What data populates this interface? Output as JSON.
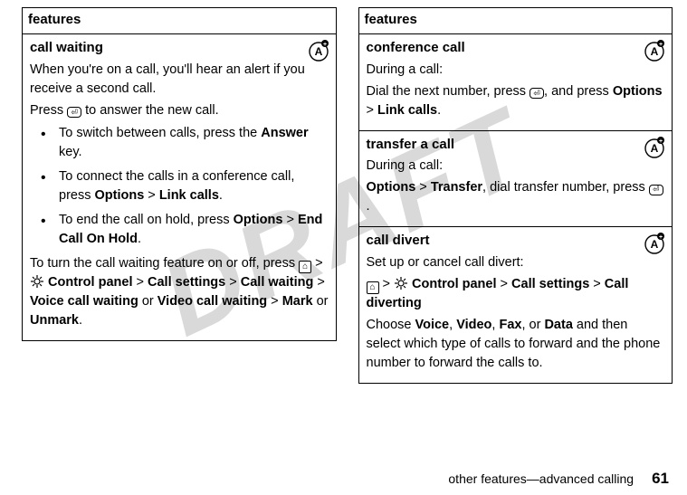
{
  "watermark": "DRAFT",
  "left": {
    "header": "features",
    "section": {
      "title": "call waiting",
      "p1a": "When you're on a call, you'll hear an alert if you receive a second call.",
      "p2a": "Press ",
      "p2b": " to answer the new call.",
      "b1a": "To switch between calls, press the ",
      "b1_answer": "Answer",
      "b1b": " key.",
      "b2a": "To connect the calls in a conference call, press ",
      "b2_options": "Options",
      "gt": " > ",
      "b2_link": "Link calls",
      "b2b": ".",
      "b3a": "To end the call on hold, press ",
      "b3_options": "Options",
      "b3_end": "End Call On Hold",
      "b3b": ".",
      "p3a": "To turn the call waiting feature on or off, press ",
      "p3_cp": " Control panel",
      "p3_cs": "Call settings",
      "p3_cw": "Call waiting",
      "p3_vcw": "Voice call waiting",
      "p3_or": " or ",
      "p3_vicw": "Video call waiting",
      "p3_mark": "Mark",
      "p3_or2": " or ",
      "p3_unmark": "Unmark",
      "p3b": "."
    }
  },
  "right": {
    "header": "features",
    "s1": {
      "title": "conference call",
      "p1": "During a call:",
      "p2a": "Dial the next number, press ",
      "p2b": ", and press ",
      "p2_options": "Options",
      "gt": " > ",
      "p2_link": "Link calls",
      "p2c": "."
    },
    "s2": {
      "title": "transfer a call",
      "p1": "During a call:",
      "p2_options": "Options",
      "gt": " > ",
      "p2_transfer": "Transfer",
      "p2a": ", dial transfer number, press ",
      "p2b": "."
    },
    "s3": {
      "title": "call divert",
      "p1": "Set up or cancel call divert:",
      "gt": " > ",
      "p2_cp": " Control panel",
      "p2_cs": "Call settings",
      "p2_cd": "Call diverting",
      "p3a": "Choose ",
      "p3_voice": "Voice",
      "c": ", ",
      "p3_video": "Video",
      "p3_fax": "Fax",
      "p3_or": ", or ",
      "p3_data": "Data",
      "p3b": " and then select which type of calls to forward and the phone number to forward the calls to."
    }
  },
  "footer": {
    "section": "other features—advanced calling",
    "page": "61"
  }
}
